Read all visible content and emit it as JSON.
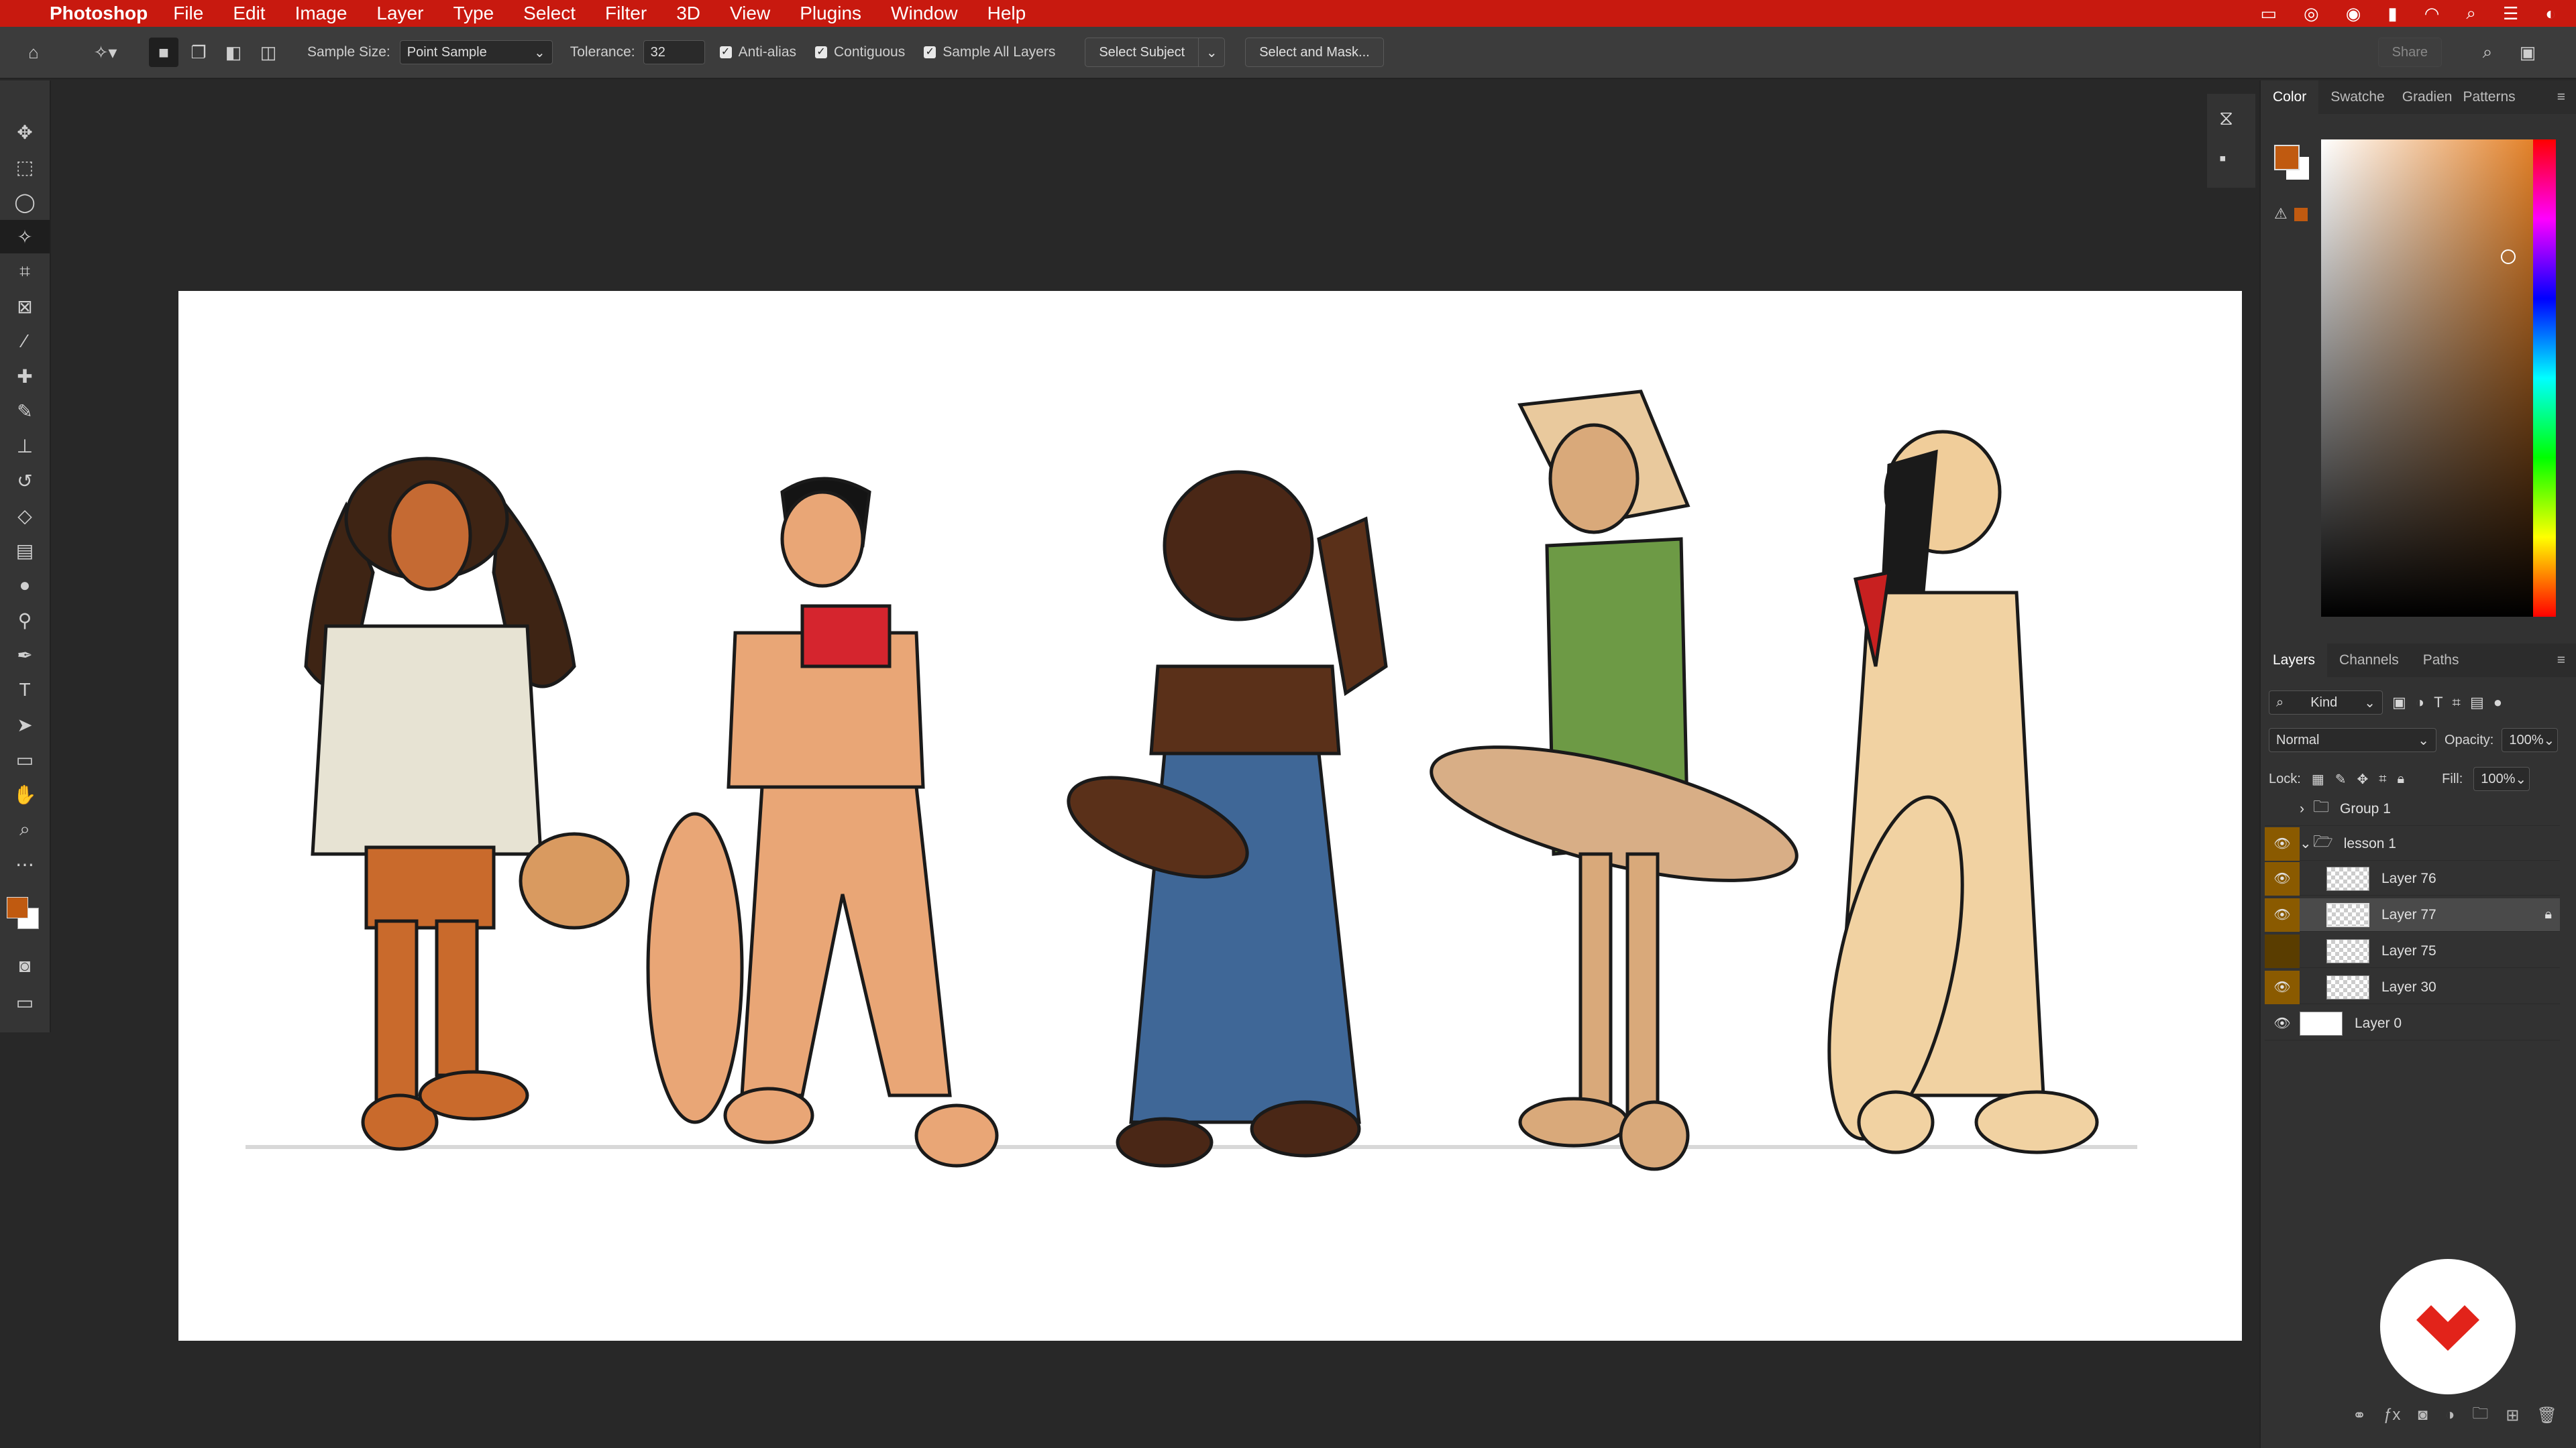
{
  "menubar": {
    "app_name": "Photoshop",
    "items": [
      "File",
      "Edit",
      "Image",
      "Layer",
      "Type",
      "Select",
      "Filter",
      "3D",
      "View",
      "Plugins",
      "Window",
      "Help"
    ]
  },
  "options_bar": {
    "sample_size_label": "Sample Size:",
    "sample_size_value": "Point Sample",
    "tolerance_label": "Tolerance:",
    "tolerance_value": "32",
    "anti_alias": "Anti-alias",
    "contiguous": "Contiguous",
    "sample_all_layers": "Sample All Layers",
    "select_subject": "Select Subject",
    "select_and_mask": "Select and Mask...",
    "share": "Share"
  },
  "color_panel": {
    "tabs": [
      "Color",
      "Swatche",
      "Gradien",
      "Patterns"
    ],
    "foreground_color": "#c05a10",
    "background_color": "#ffffff"
  },
  "layers_panel": {
    "tabs": [
      "Layers",
      "Channels",
      "Paths"
    ],
    "filter_kind": "Kind",
    "blend_mode": "Normal",
    "opacity_label": "Opacity:",
    "opacity_value": "100%",
    "lock_label": "Lock:",
    "fill_label": "Fill:",
    "fill_value": "100%",
    "layers": [
      {
        "name": "Group 1",
        "visible": false,
        "type": "group",
        "collapsed": true
      },
      {
        "name": "lesson 1",
        "visible": true,
        "type": "group",
        "collapsed": false
      },
      {
        "name": "Layer 76",
        "visible": true,
        "type": "layer"
      },
      {
        "name": "Layer 77",
        "visible": true,
        "type": "layer",
        "selected": true,
        "locked": true
      },
      {
        "name": "Layer 75",
        "visible": false,
        "type": "layer"
      },
      {
        "name": "Layer 30",
        "visible": true,
        "type": "layer"
      },
      {
        "name": "Layer 0",
        "visible": true,
        "type": "layer"
      }
    ]
  },
  "colors": {
    "accent": "#c8190f",
    "orange": "#c05a10",
    "eye_highlight": "#8a5a00"
  }
}
